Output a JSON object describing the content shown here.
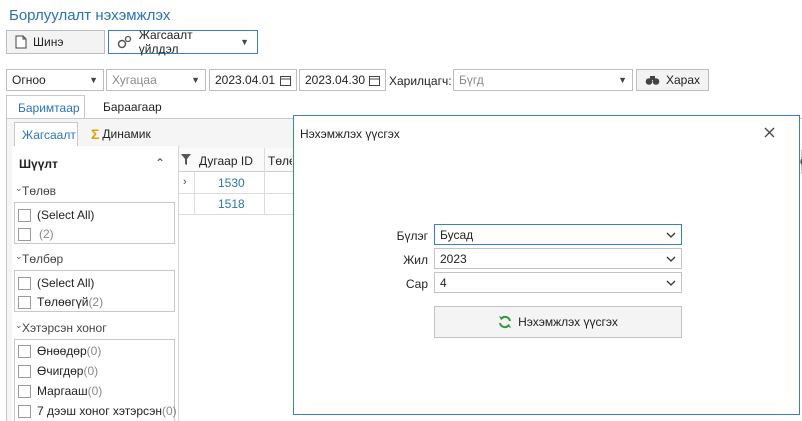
{
  "app": {
    "title": "Борлуулалт нэхэмжлэх"
  },
  "toolbar": {
    "new_label": "Шинэ",
    "list_op_label": "Жагсаалт үйлдэл"
  },
  "filters": {
    "order_by": "Огноо",
    "period_placeholder": "Хугацаа",
    "date_from": "2023.04.01",
    "date_to": "2023.04.30",
    "customer_label": "Харилцагч:",
    "customer_placeholder": "Бүгд",
    "view_label": "Харах"
  },
  "tabs": {
    "documents": "Баримтаар",
    "products": "Бараагаар"
  },
  "subtabs": {
    "list": "Жагсаалт",
    "dynamic": "Динамик"
  },
  "filter_panel": {
    "title": "Шүүлт",
    "sections": [
      {
        "label": "Төлөв",
        "items": [
          {
            "label": "(Select All)",
            "count": ""
          },
          {
            "label": "",
            "count": "(2)"
          }
        ]
      },
      {
        "label": "Төлбөр",
        "items": [
          {
            "label": "(Select All)",
            "count": ""
          },
          {
            "label": "Төлөөгүй",
            "count": "(2)"
          }
        ]
      },
      {
        "label": "Хэтэрсэн хоног",
        "items": [
          {
            "label": "Өнөөдөр",
            "count": "(0)"
          },
          {
            "label": "Өчигдөр",
            "count": "(0)"
          },
          {
            "label": "Маргааш",
            "count": "(0)"
          },
          {
            "label": "7 дээш хоног хэтэрсэн",
            "count": "(0)"
          }
        ]
      }
    ]
  },
  "grid": {
    "columns": [
      "Дугаар ID",
      "Төлө"
    ],
    "rows": [
      {
        "id": "1530"
      },
      {
        "id": "1518"
      }
    ]
  },
  "modal": {
    "title": "Нэхэмжлэх үүсгэх",
    "fields": [
      {
        "label": "Бүлэг",
        "value": "Бусад"
      },
      {
        "label": "Жил",
        "value": "2023"
      },
      {
        "label": "Сар",
        "value": "4"
      }
    ],
    "submit_label": "Нэхэмжлэх үүсгэх"
  }
}
